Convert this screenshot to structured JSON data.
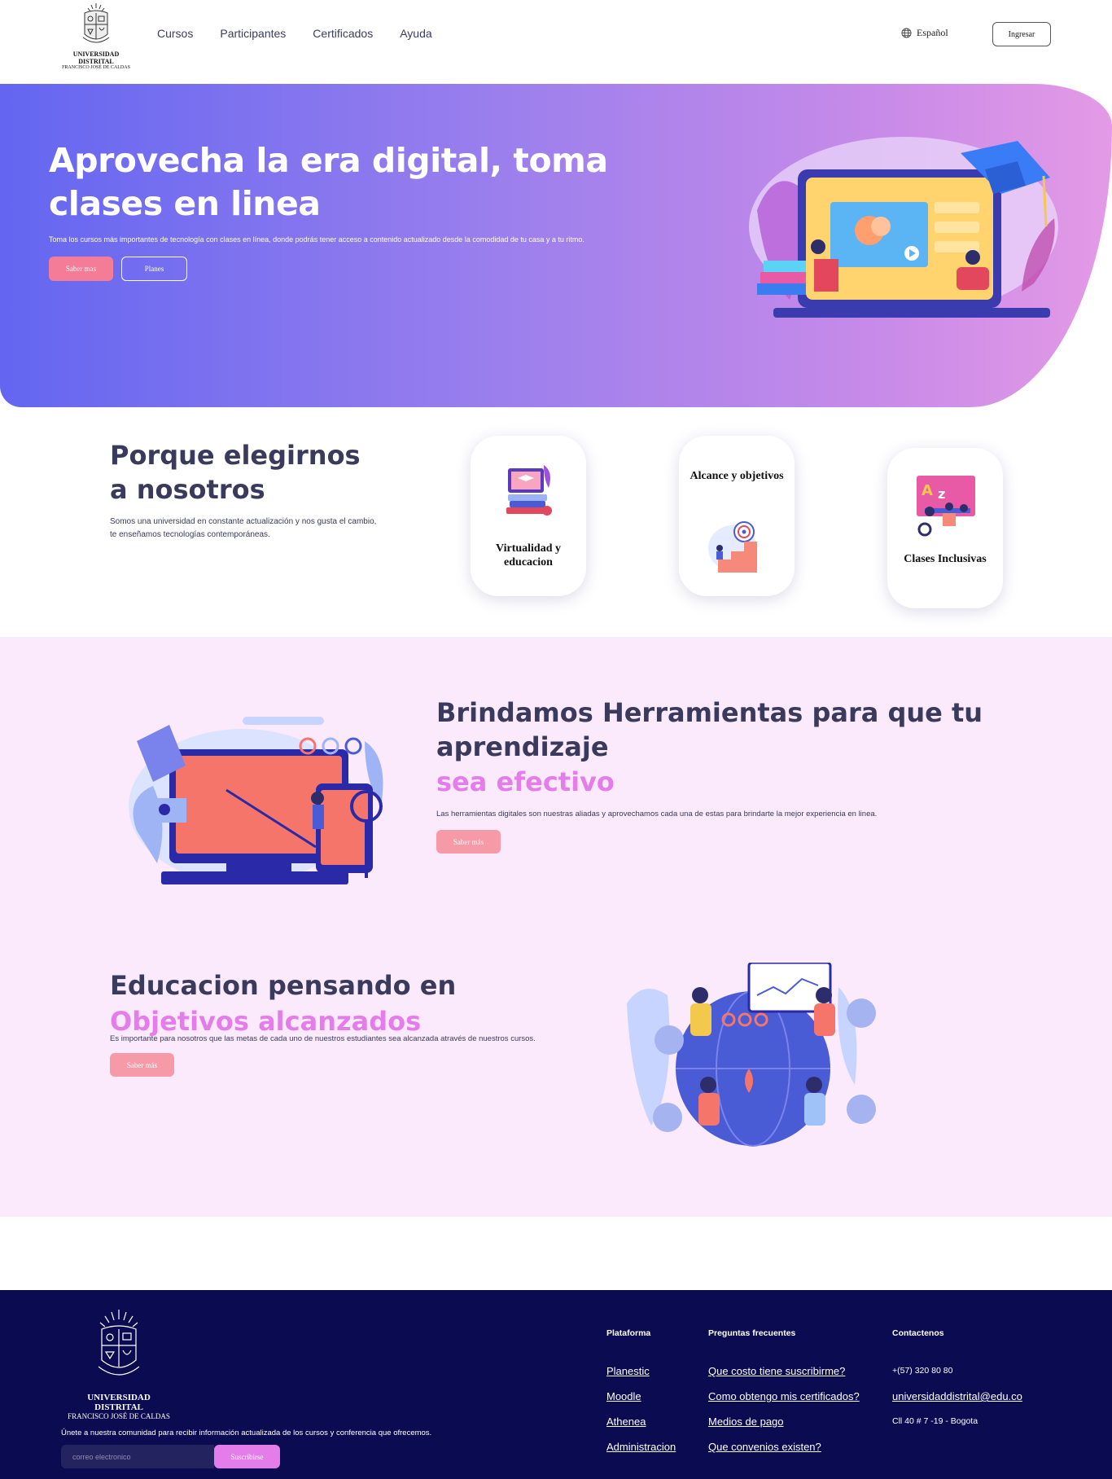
{
  "brand": {
    "logo_line1": "UNIVERSIDAD DISTRITAL",
    "logo_line2": "FRANCISCO JOSÉ DE CALDAS"
  },
  "nav": {
    "links": [
      "Cursos",
      "Participantes",
      "Certificados",
      "Ayuda"
    ],
    "language": "Español",
    "login_label": "Ingresar"
  },
  "hero": {
    "title": "Aprovecha la era digital, toma clases en linea",
    "subtitle": "Toma los cursos más importantes de tecnología con clases en línea, donde podrás tener acceso a contenido actualizado desde la comodidad de tu casa y a tu ritmo.",
    "primary_button": "Saber mas",
    "secondary_button": "Planes"
  },
  "why": {
    "title": "Porque elegirnos a nosotros",
    "text": "Somos una universidad en constante actualización y nos gusta el cambio, te enseñamos tecnologías contemporáneas.",
    "cards": [
      {
        "label": "Virtualidad y educacion",
        "icon": "laptop-books-icon"
      },
      {
        "label": "Alcance y objetivos",
        "icon": "target-stairs-icon"
      },
      {
        "label": "Clases Inclusivas",
        "icon": "classroom-icon"
      }
    ]
  },
  "features": {
    "tools": {
      "title": "Brindamos Herramientas para que tu aprendizaje",
      "accent": "sea efectivo",
      "text": "Las herramientas digitales son nuestras aliadas y aprovechamos cada una de estas para brindarte la mejor experiencia en linea.",
      "button": "Saber más"
    },
    "goals": {
      "title": "Educacion pensando en",
      "accent": "Objetivos alcanzados",
      "text": "Es importante para nosotros que las metas de cada uno de nuestros estudiantes sea alcanzada através de nuestros cursos.",
      "button": "Saber más"
    }
  },
  "footer": {
    "logo_line1": "UNIVERSIDAD DISTRITAL",
    "logo_line2": "FRANCISCO JOSÉ DE CALDAS",
    "join_text": "Únete a nuestra comunidad para recibir información actualizada de los cursos y conferencia que ofrecemos.",
    "email_placeholder": "correo electronico",
    "subscribe_label": "Suscribirse",
    "platform": {
      "title": "Plataforma",
      "links": [
        "Planestic",
        "Moodle",
        "Athenea",
        "Administracion"
      ]
    },
    "faq": {
      "title": "Preguntas frecuentes",
      "links": [
        "Que costo tiene suscribirme?",
        "Como obtengo mis certificados?",
        "Medios de pago",
        "Que convenios existen?"
      ]
    },
    "contact": {
      "title": "Contactenos",
      "phone": "+(57) 320 80 80",
      "email": "universidaddistrital@edu.co",
      "address": "Cll 40 # 7 -19 - Bogota"
    }
  },
  "colors": {
    "accent_pink": "#e47ce9",
    "button_pink": "#f47c96",
    "footer_navy": "#0b0b52",
    "heading": "#3a3a5c",
    "section_pink": "#fbeafc"
  }
}
